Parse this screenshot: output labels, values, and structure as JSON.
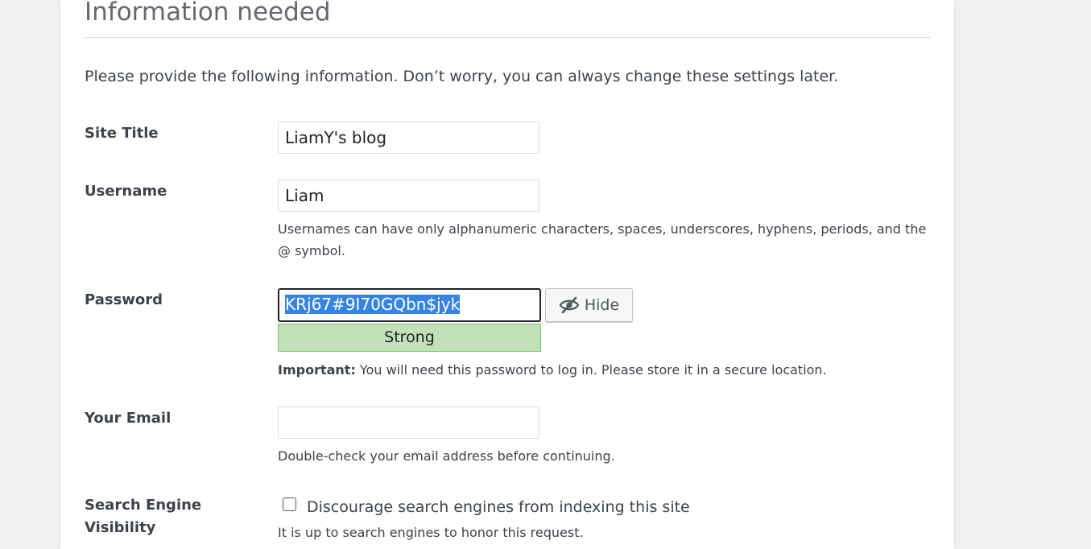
{
  "heading": "Information needed",
  "intro": "Please provide the following information. Don’t worry, you can always change these settings later.",
  "site_title": {
    "label": "Site Title",
    "value": "LiamY's blog"
  },
  "username": {
    "label": "Username",
    "value": "Liam",
    "help_line1": "Usernames can have only alphanumeric characters, spaces, underscores, hyphens, periods, and the",
    "help_line2": "@ symbol."
  },
  "password": {
    "label": "Password",
    "value": "KRj67#9I70GQbn$jyk",
    "hide_button": "Hide",
    "hide_icon": "eye-slash-icon",
    "strength": "Strong",
    "important_label": "Important:",
    "important_text": " You will need this password to log in. Please store it in a secure location."
  },
  "email": {
    "label": "Your Email",
    "value": "",
    "help": "Double-check your email address before continuing."
  },
  "search_visibility": {
    "label_line1": "Search Engine",
    "label_line2": "Visibility",
    "checkbox_label": "Discourage search engines from indexing this site",
    "checked": false,
    "help": "It is up to search engines to honor this request."
  },
  "colors": {
    "strength_bg": "#c1e1b9",
    "strength_border": "#83c373",
    "selection": "#3584e4"
  }
}
